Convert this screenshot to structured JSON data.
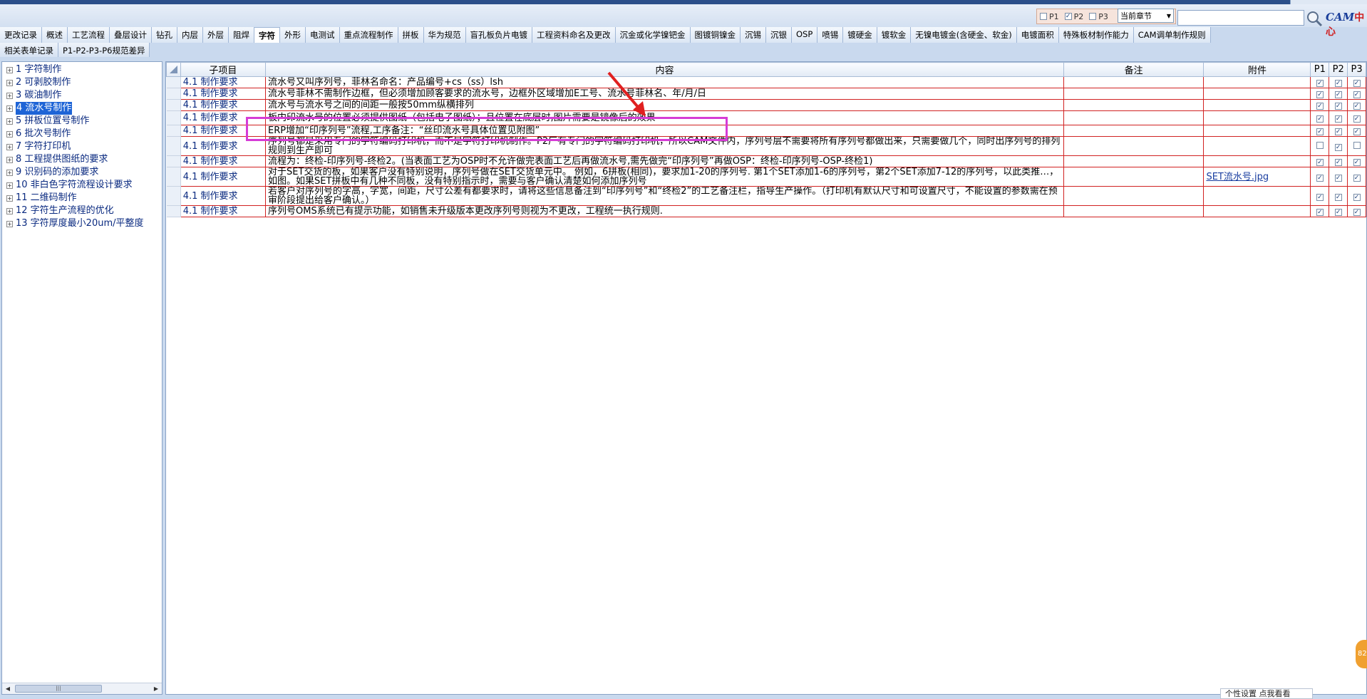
{
  "toolbar": {
    "filters": [
      {
        "label": "P1",
        "checked": false
      },
      {
        "label": "P2",
        "checked": true
      },
      {
        "label": "P3",
        "checked": false
      }
    ],
    "chapter_select": "当前章节",
    "search_value": "",
    "logo_text": "CAM",
    "logo_zh": "中心"
  },
  "tabs": [
    "更改记录",
    "概述",
    "工艺流程",
    "叠层设计",
    "钻孔",
    "内层",
    "外层",
    "阻焊",
    "字符",
    "外形",
    "电测试",
    "重点流程制作",
    "拼板",
    "华为规范",
    "盲孔板负片电镀",
    "工程资料命名及更改",
    "沉金或化学镍钯金",
    "图镀铜镍金",
    "沉锡",
    "沉银",
    "OSP",
    "喷锡",
    "镀硬金",
    "镀软金",
    "无镍电镀金(含硬金、软金)",
    "电镀面积",
    "特殊板材制作能力",
    "CAM调单制作规则"
  ],
  "tabs_row2": [
    "相关表单记录",
    "P1-P2-P3-P6规范差异"
  ],
  "active_tab": "字符",
  "tree": [
    {
      "label": "1  字符制作",
      "selected": false
    },
    {
      "label": "2  可剥胶制作",
      "selected": false
    },
    {
      "label": "3  碳油制作",
      "selected": false
    },
    {
      "label": "4  流水号制作",
      "selected": true
    },
    {
      "label": "5  拼板位置号制作",
      "selected": false
    },
    {
      "label": "6  批次号制作",
      "selected": false
    },
    {
      "label": "7  字符打印机",
      "selected": false
    },
    {
      "label": "8  工程提供图纸的要求",
      "selected": false
    },
    {
      "label": "9  识别码的添加要求",
      "selected": false
    },
    {
      "label": "10  非白色字符流程设计要求",
      "selected": false
    },
    {
      "label": "11  二维码制作",
      "selected": false
    },
    {
      "label": "12  字符生产流程的优化",
      "selected": false
    },
    {
      "label": "13  字符厚度最小20um/平整度",
      "selected": false
    }
  ],
  "grid": {
    "headers": {
      "sub": "子项目",
      "content": "内容",
      "remark": "备注",
      "attachment": "附件",
      "p1": "P1",
      "p2": "P2",
      "p3": "P3"
    },
    "rows": [
      {
        "sub": "4.1 制作要求",
        "content": "流水号又叫序列号，菲林名命名：产品编号+cs（ss）lsh",
        "remark": "",
        "attachment": "",
        "p1": true,
        "p2": true,
        "p3": true
      },
      {
        "sub": "4.1 制作要求",
        "content": "流水号菲林不需制作边框，但必须增加顾客要求的流水号，边框外区域增加E工号、流水号菲林名、年/月/日",
        "remark": "",
        "attachment": "",
        "p1": true,
        "p2": true,
        "p3": true
      },
      {
        "sub": "4.1 制作要求",
        "content": "流水号与流水号之间的间距一般按50mm纵横排列",
        "remark": "",
        "attachment": "",
        "p1": true,
        "p2": true,
        "p3": true
      },
      {
        "sub": "4.1 制作要求",
        "content": "板内印流水号的位置必须提供图纸（包括电子图纸）；且位置在底层时,图片需要是镜像后的效果",
        "remark": "",
        "attachment": "",
        "p1": true,
        "p2": true,
        "p3": true
      },
      {
        "sub": "4.1 制作要求",
        "content": "ERP增加“印序列号”流程,工序备注：“丝印流水号具体位置见附图”",
        "remark": "",
        "attachment": "",
        "p1": true,
        "p2": true,
        "p3": true
      },
      {
        "sub": "4.1 制作要求",
        "content": "序列号都是采用专门的字符编码打印机，而不是字符打印机制作。P2厂有专门的字符编码打印机，所以CAM文件内，序列号层不需要将所有序列号都做出来，只需要做几个，同时出序列号的排列规则到生产即可",
        "remark": "",
        "attachment": "",
        "p1": false,
        "p2": true,
        "p3": false
      },
      {
        "sub": "4.1 制作要求",
        "content": "流程为：终检-印序列号-终检2。(当表面工艺为OSP时不允许做完表面工艺后再做流水号,需先做完“印序列号”再做OSP：终检-印序列号-OSP-终检1)",
        "remark": "",
        "attachment": "",
        "p1": true,
        "p2": true,
        "p3": true
      },
      {
        "sub": "4.1 制作要求",
        "content": "对于SET交货的板，如果客户没有特别说明，序列号做在SET交货单元中。 例如，6拼板(相同)，要求加1-20的序列号. 第1个SET添加1-6的序列号，第2个SET添加7-12的序列号，以此类推…，如图。如果SET拼板中有几种不同板，没有特别指示时，需要与客户确认清楚如何添加序列号",
        "remark": "",
        "attachment": "SET流水号.jpg",
        "p1": true,
        "p2": true,
        "p3": true
      },
      {
        "sub": "4.1 制作要求",
        "content": "若客户对序列号的字高，字宽，间距，尺寸公差有都要求时，请将这些信息备注到“印序列号”和“终检2”的工艺备注栏，指导生产操作。（打印机有默认尺寸和可设置尺寸，不能设置的参数需在预审阶段提出给客户确认。）",
        "remark": "",
        "attachment": "",
        "p1": true,
        "p2": true,
        "p3": true
      },
      {
        "sub": "4.1 制作要求",
        "content": "序列号OMS系统已有提示功能，如销售未升级版本更改序列号则视为不更改，工程统一执行规则.",
        "remark": "",
        "attachment": "",
        "p1": true,
        "p2": true,
        "p3": true
      }
    ]
  },
  "bottom_popup": "个性设置    点我看看",
  "float_badge": "82"
}
